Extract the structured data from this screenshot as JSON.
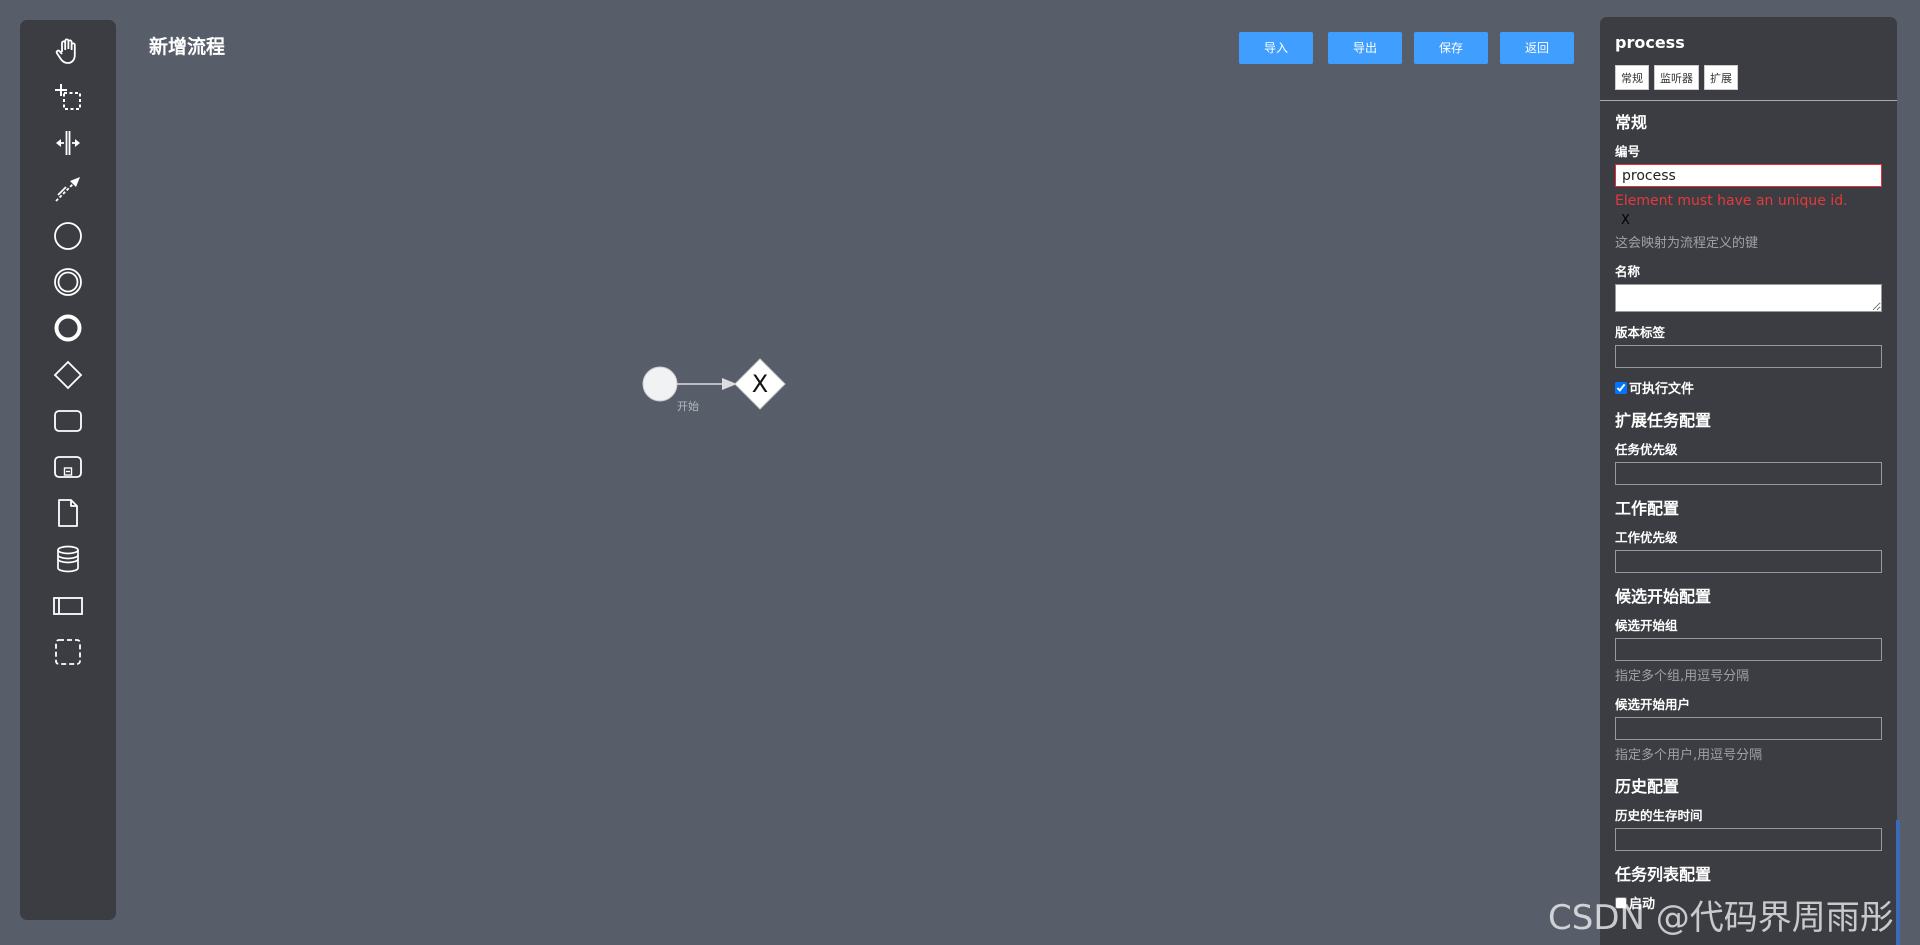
{
  "page": {
    "title": "新增流程"
  },
  "toolbar": {
    "import_label": "导入",
    "export_label": "导出",
    "save_label": "保存",
    "back_label": "返回"
  },
  "palette": {
    "tools": [
      "hand-tool-icon",
      "lasso-tool-icon",
      "space-tool-icon",
      "connect-tool-icon",
      "start-event-icon",
      "intermediate-event-icon",
      "end-event-icon",
      "gateway-icon",
      "task-icon",
      "subprocess-icon",
      "data-object-icon",
      "data-store-icon",
      "pool-icon",
      "group-icon"
    ]
  },
  "diagram": {
    "start_label": "开始",
    "gateway_symbol": "X"
  },
  "panel": {
    "title": "process",
    "tabs": [
      "常规",
      "监听器",
      "扩展"
    ],
    "general": {
      "heading": "常规",
      "id_label": "编号",
      "id_value": "process",
      "id_error": "Element must have an unique id.",
      "clear_symbol": "X",
      "id_hint": "这会映射为流程定义的键",
      "name_label": "名称",
      "version_label": "版本标签",
      "executable_label": "可执行文件",
      "executable_checked": true
    },
    "task_config": {
      "heading": "扩展任务配置",
      "priority_label": "任务优先级"
    },
    "job_config": {
      "heading": "工作配置",
      "priority_label": "工作优先级"
    },
    "starter_config": {
      "heading": "候选开始配置",
      "groups_label": "候选开始组",
      "groups_hint": "指定多个组,用逗号分隔",
      "users_label": "候选开始用户",
      "users_hint": "指定多个用户,用逗号分隔"
    },
    "history_config": {
      "heading": "历史配置",
      "ttl_label": "历史的生存时间"
    },
    "tasklist_config": {
      "heading": "任务列表配置",
      "startable_label": "启动"
    }
  },
  "watermark": "CSDN @代码界周雨彤",
  "colors": {
    "accent": "#409eff",
    "canvas_bg": "#575e69",
    "panel_bg": "#3c3d42",
    "error": "#e4393c"
  }
}
